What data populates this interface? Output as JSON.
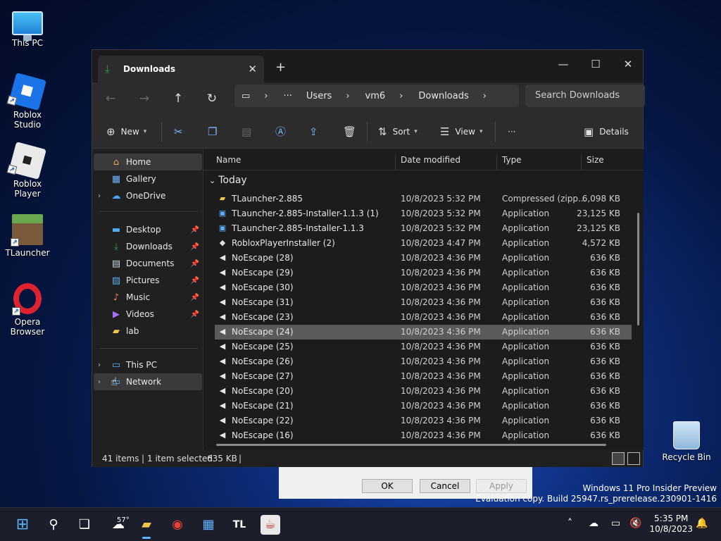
{
  "desktop": {
    "icons": [
      {
        "label": "This PC"
      },
      {
        "label": "Roblox Studio"
      },
      {
        "label": "Roblox Player"
      },
      {
        "label": "TLauncher"
      },
      {
        "label": "Opera Browser"
      },
      {
        "label": "Recycle Bin"
      }
    ]
  },
  "window": {
    "tab_title": "Downloads",
    "new_tab": "+",
    "controls": {
      "minimize": "—",
      "maximize": "☐",
      "close": "✕"
    },
    "nav": {
      "back": "←",
      "forward": "→",
      "up": "↑",
      "refresh": "↻"
    },
    "address": {
      "crumbs": [
        "Users",
        "vm6",
        "Downloads"
      ],
      "more": "···"
    },
    "search_placeholder": "Search Downloads",
    "toolbar": {
      "new": "New",
      "sort": "Sort",
      "view": "View",
      "more": "···",
      "details": "Details"
    },
    "sidebar": {
      "home": "Home",
      "gallery": "Gallery",
      "onedrive": "OneDrive",
      "desktop": "Desktop",
      "downloads": "Downloads",
      "documents": "Documents",
      "pictures": "Pictures",
      "music": "Music",
      "videos": "Videos",
      "lab": "lab",
      "thispc": "This PC",
      "network": "Network"
    },
    "columns": {
      "name": "Name",
      "date": "Date modified",
      "type": "Type",
      "size": "Size"
    },
    "group": "Today",
    "files": [
      {
        "name": "TLauncher-2.885",
        "date": "10/8/2023 5:32 PM",
        "type": "Compressed (zipp...",
        "size": "6,098 KB",
        "icon": "zip-folder-icon"
      },
      {
        "name": "TLauncher-2.885-Installer-1.1.3 (1)",
        "date": "10/8/2023 5:32 PM",
        "type": "Application",
        "size": "23,125 KB",
        "icon": "tl-app-icon"
      },
      {
        "name": "TLauncher-2.885-Installer-1.1.3",
        "date": "10/8/2023 5:32 PM",
        "type": "Application",
        "size": "23,125 KB",
        "icon": "tl-app-icon"
      },
      {
        "name": "RobloxPlayerInstaller (2)",
        "date": "10/8/2023 4:47 PM",
        "type": "Application",
        "size": "4,572 KB",
        "icon": "roblox-app-icon"
      },
      {
        "name": "NoEscape (28)",
        "date": "10/8/2023 4:36 PM",
        "type": "Application",
        "size": "636 KB",
        "icon": "speaker-app-icon"
      },
      {
        "name": "NoEscape (29)",
        "date": "10/8/2023 4:36 PM",
        "type": "Application",
        "size": "636 KB",
        "icon": "speaker-app-icon"
      },
      {
        "name": "NoEscape (30)",
        "date": "10/8/2023 4:36 PM",
        "type": "Application",
        "size": "636 KB",
        "icon": "speaker-app-icon"
      },
      {
        "name": "NoEscape (31)",
        "date": "10/8/2023 4:36 PM",
        "type": "Application",
        "size": "636 KB",
        "icon": "speaker-app-icon"
      },
      {
        "name": "NoEscape (23)",
        "date": "10/8/2023 4:36 PM",
        "type": "Application",
        "size": "636 KB",
        "icon": "speaker-app-icon"
      },
      {
        "name": "NoEscape (24)",
        "date": "10/8/2023 4:36 PM",
        "type": "Application",
        "size": "636 KB",
        "icon": "speaker-app-icon",
        "selected": true
      },
      {
        "name": "NoEscape (25)",
        "date": "10/8/2023 4:36 PM",
        "type": "Application",
        "size": "636 KB",
        "icon": "speaker-app-icon"
      },
      {
        "name": "NoEscape (26)",
        "date": "10/8/2023 4:36 PM",
        "type": "Application",
        "size": "636 KB",
        "icon": "speaker-app-icon"
      },
      {
        "name": "NoEscape (27)",
        "date": "10/8/2023 4:36 PM",
        "type": "Application",
        "size": "636 KB",
        "icon": "speaker-app-icon"
      },
      {
        "name": "NoEscape (20)",
        "date": "10/8/2023 4:36 PM",
        "type": "Application",
        "size": "636 KB",
        "icon": "speaker-app-icon"
      },
      {
        "name": "NoEscape (21)",
        "date": "10/8/2023 4:36 PM",
        "type": "Application",
        "size": "636 KB",
        "icon": "speaker-app-icon"
      },
      {
        "name": "NoEscape (22)",
        "date": "10/8/2023 4:36 PM",
        "type": "Application",
        "size": "636 KB",
        "icon": "speaker-app-icon"
      },
      {
        "name": "NoEscape (16)",
        "date": "10/8/2023 4:36 PM",
        "type": "Application",
        "size": "636 KB",
        "icon": "speaker-app-icon"
      }
    ],
    "status": {
      "count": "41 items",
      "selected": "1 item selected",
      "size": "635 KB"
    }
  },
  "dialog": {
    "ok": "OK",
    "cancel": "Cancel",
    "apply": "Apply"
  },
  "watermark": {
    "line1": "Windows 11 Pro Insider Preview",
    "line2": "Evaluation copy. Build 25947.rs_prerelease.230901-1416"
  },
  "taskbar": {
    "weather": "57°",
    "time": "5:35 PM",
    "date": "10/8/2023",
    "tl_label": "TL"
  },
  "colors": {
    "accent": "#5fb2ff",
    "selected_row": "#5a5a5a",
    "window_bg": "#202020"
  }
}
